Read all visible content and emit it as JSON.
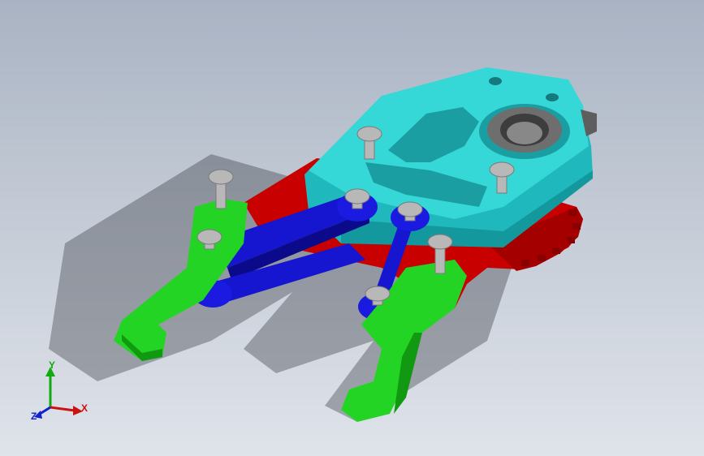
{
  "viewport": {
    "background_top": "#a9b3c3",
    "background_bottom": "#dfe3ea"
  },
  "model": {
    "parts": [
      {
        "name": "base-plate",
        "color": "#2fd0d0"
      },
      {
        "name": "drive-gear",
        "color": "#cc0000"
      },
      {
        "name": "linkage-arms",
        "color": "#1a1acc"
      },
      {
        "name": "gripper-jaws",
        "color": "#19d31a"
      },
      {
        "name": "pins",
        "color": "#b4b4b4"
      }
    ]
  },
  "triad": {
    "x_label": "X",
    "y_label": "Y",
    "z_label": "Z",
    "x_color": "#cc1111",
    "y_color": "#11aa11",
    "z_color": "#1122cc"
  }
}
